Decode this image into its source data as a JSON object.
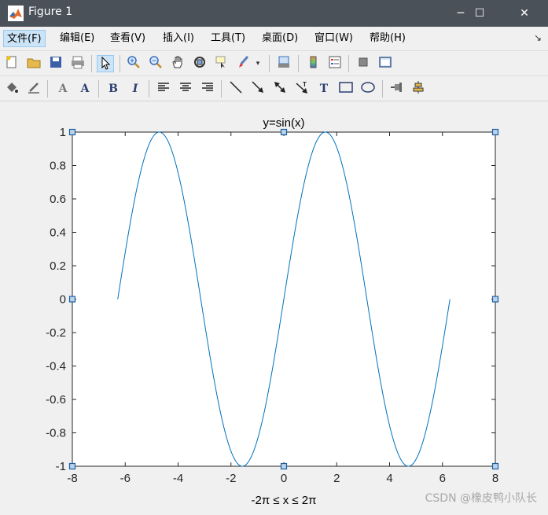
{
  "window": {
    "title": "Figure 1",
    "controls": {
      "minimize": "─",
      "maximize": "☐",
      "close": "✕"
    }
  },
  "menubar": {
    "items": [
      "文件(F)",
      "编辑(E)",
      "查看(V)",
      "插入(I)",
      "工具(T)",
      "桌面(D)",
      "窗口(W)",
      "帮助(H)"
    ],
    "active_index": 0,
    "overflow_icon": "dock-arrow-icon"
  },
  "toolbar1": {
    "buttons": [
      "new-figure-icon",
      "open-file-icon",
      "save-icon",
      "print-icon",
      "edit-plot-arrow-icon",
      "zoom-in-icon",
      "zoom-out-icon",
      "pan-hand-icon",
      "rotate-3d-icon",
      "data-cursor-icon",
      "brush-icon",
      "link-plot-icon",
      "colorbar-icon",
      "legend-icon",
      "hide-plot-tools-icon",
      "show-plot-tools-icon"
    ]
  },
  "toolbar2": {
    "buttons": [
      "face-color-icon",
      "edge-color-icon",
      "font-icon",
      "text-color-icon",
      "bold-icon",
      "italic-icon",
      "align-left-icon",
      "align-center-icon",
      "align-right-icon",
      "line-icon",
      "arrow-icon",
      "double-arrow-icon",
      "text-arrow-icon",
      "text-box-icon",
      "rectangle-icon",
      "ellipse-icon",
      "pin-icon",
      "align-distribute-icon"
    ],
    "glyphs": {
      "font": "A",
      "text_color": "A",
      "bold": "B",
      "italic": "I",
      "text_box": "T"
    }
  },
  "colors": {
    "titlebar": "#4a5159",
    "series": "#0072bd",
    "selection_handle": "#1f5f9e"
  },
  "chart_data": {
    "type": "line",
    "title": "y=sin(x)",
    "xlabel": "-2π ≤ x ≤ 2π",
    "ylabel": "",
    "xlim": [
      -8,
      8
    ],
    "ylim": [
      -1,
      1
    ],
    "xticks": [
      -8,
      -6,
      -4,
      -2,
      0,
      2,
      4,
      6,
      8
    ],
    "yticks": [
      -1,
      -0.8,
      -0.6,
      -0.4,
      -0.2,
      0,
      0.2,
      0.4,
      0.6,
      0.8,
      1
    ],
    "xtick_labels": [
      "-8",
      "-6",
      "-4",
      "-2",
      "0",
      "2",
      "4",
      "6",
      "8"
    ],
    "ytick_labels": [
      "-1",
      "-0.8",
      "-0.6",
      "-0.4",
      "-0.2",
      "0",
      "0.2",
      "0.4",
      "0.6",
      "0.8",
      "1"
    ],
    "grid": false,
    "series": [
      {
        "function": "sin",
        "x_range": [
          -6.2832,
          6.2832
        ],
        "color": "#0072bd"
      }
    ]
  },
  "watermark": "CSDN @橡皮鸭小队长"
}
